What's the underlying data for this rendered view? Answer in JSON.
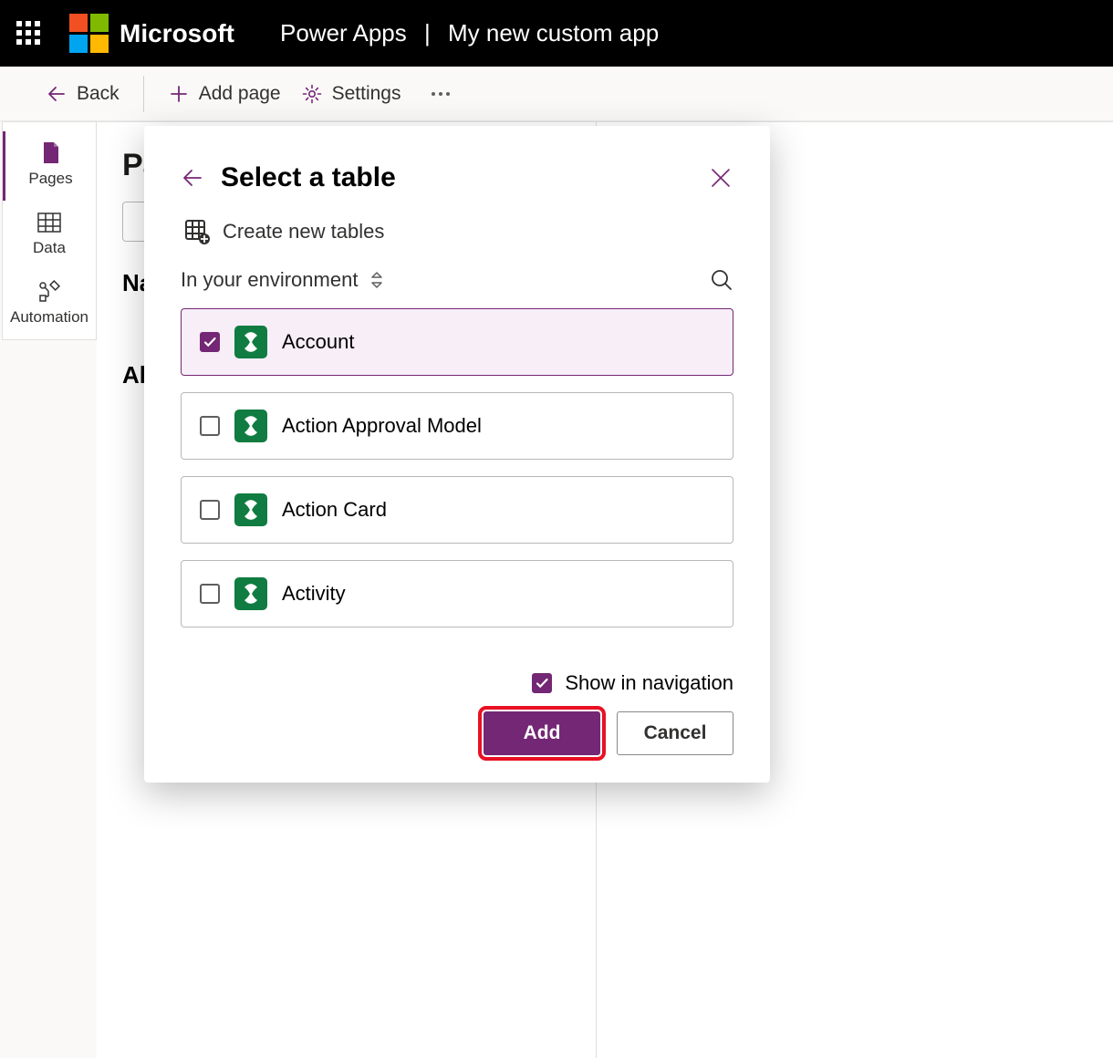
{
  "header": {
    "brand": "Microsoft",
    "product": "Power Apps",
    "app_name": "My new custom app"
  },
  "toolbar": {
    "back": "Back",
    "add_page": "Add page",
    "settings": "Settings"
  },
  "rail": {
    "items": [
      "Pages",
      "Data",
      "Automation"
    ],
    "active": 0
  },
  "main": {
    "title_partial": "Pa",
    "heading2_partial": "Na",
    "all_partial": "Al"
  },
  "modal": {
    "title": "Select a table",
    "create_new": "Create new tables",
    "env_label": "In your environment",
    "show_nav": "Show in navigation",
    "add_btn": "Add",
    "cancel_btn": "Cancel",
    "tables": [
      {
        "name": "Account",
        "selected": true
      },
      {
        "name": "Action Approval Model",
        "selected": false
      },
      {
        "name": "Action Card",
        "selected": false
      },
      {
        "name": "Activity",
        "selected": false
      }
    ]
  }
}
